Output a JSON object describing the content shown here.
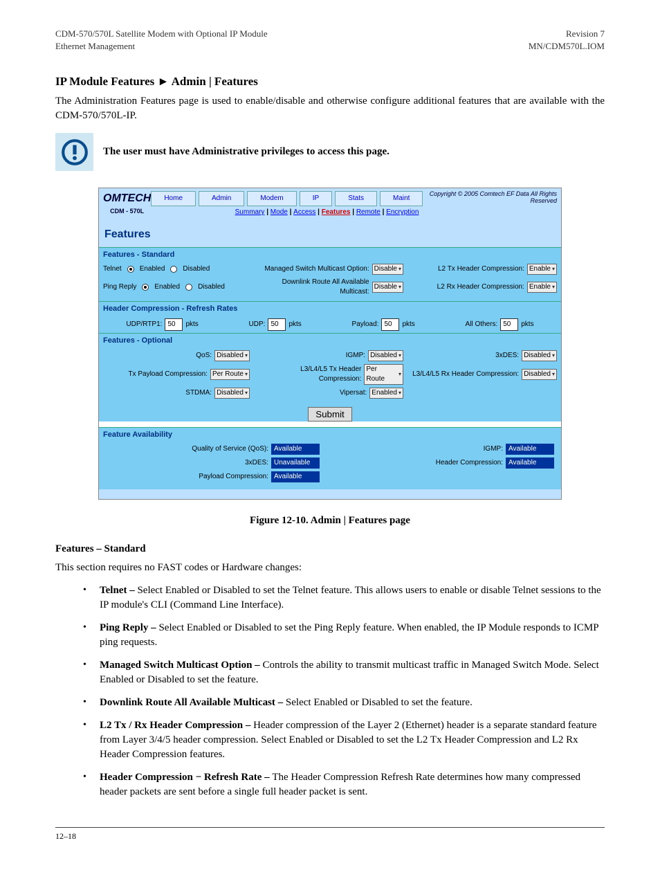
{
  "header": {
    "left_line1": "CDM-570/570L Satellite Modem with Optional IP Module",
    "left_line2": "Ethernet Management",
    "right_line1": "Revision 7",
    "right_line2": "MN/CDM570L.IOM"
  },
  "title": "IP Module Features ► Admin | Features",
  "intro": "The Administration Features page is used to enable/disable and otherwise configure additional features that are available with the CDM-570/570L-IP.",
  "alert": "The user must have Administrative privileges to access this page.",
  "screenshot": {
    "brand_line1": "OMTECH",
    "model": "CDM - 570L",
    "tabs": [
      "Home",
      "Admin",
      "Modem",
      "IP",
      "Stats",
      "Maint"
    ],
    "copyright": "Copyright © 2005\nComtech EF Data\nAll Rights Reserved",
    "subnav": [
      {
        "label": "Summary",
        "active": false
      },
      {
        "label": "Mode",
        "active": false
      },
      {
        "label": "Access",
        "active": false
      },
      {
        "label": "Features",
        "active": true
      },
      {
        "label": "Remote",
        "active": false
      },
      {
        "label": "Encryption",
        "active": false
      }
    ],
    "page_title": "Features",
    "sections": {
      "std": {
        "title": "Features - Standard",
        "rows": [
          {
            "label": "Telnet",
            "enabled": "Enabled",
            "disabled": "Disabled",
            "checked": "enabled",
            "rlabel": "Managed Switch Multicast Option:",
            "rvalue": "Disable",
            "r2label": "L2 Tx Header Compression:",
            "r2value": "Enable"
          },
          {
            "label": "Ping Reply",
            "enabled": "Enabled",
            "disabled": "Disabled",
            "checked": "enabled",
            "rlabel": "Downlink Route All Available Multicast:",
            "rvalue": "Disable",
            "r2label": "L2 Rx Header Compression:",
            "r2value": "Enable"
          }
        ]
      },
      "hcr": {
        "title": "Header Compression - Refresh Rates",
        "items": [
          {
            "label": "UDP/RTP1:",
            "value": "50",
            "unit": "pkts"
          },
          {
            "label": "UDP:",
            "value": "50",
            "unit": "pkts"
          },
          {
            "label": "Payload:",
            "value": "50",
            "unit": "pkts"
          },
          {
            "label": "All Others:",
            "value": "50",
            "unit": "pkts"
          }
        ]
      },
      "opt": {
        "title": "Features - Optional",
        "rows": [
          [
            {
              "label": "QoS:",
              "value": "Disabled"
            },
            {
              "label": "IGMP:",
              "value": "Disabled"
            },
            {
              "label": "3xDES:",
              "value": "Disabled"
            }
          ],
          [
            {
              "label": "Tx Payload Compression:",
              "value": "Per Route"
            },
            {
              "label": "L3/L4/L5 Tx Header Compression:",
              "value": "Per Route"
            },
            {
              "label": "L3/L4/L5 Rx Header Compression:",
              "value": "Disabled"
            }
          ],
          [
            {
              "label": "STDMA:",
              "value": "Disabled"
            },
            {
              "label": "Vipersat:",
              "value": "Enabled"
            },
            {
              "label": "",
              "value": ""
            }
          ]
        ],
        "submit": "Submit"
      },
      "avail": {
        "title": "Feature Availability",
        "items": [
          {
            "label": "Quality of Service (QoS):",
            "status": "Available"
          },
          {
            "label": "IGMP:",
            "status": "Available"
          },
          {
            "label": "3xDES:",
            "status": "Unavailable"
          },
          {
            "label": "Header Compression:",
            "status": "Available"
          },
          {
            "label": "Payload Compression:",
            "status": "Available"
          }
        ]
      }
    }
  },
  "caption": "Figure 12-10. Admin | Features page",
  "sub1_title": "Features – Standard",
  "sub1_intro": "This section requires no FAST codes or Hardware changes:",
  "bullets": [
    {
      "b": "Telnet – ",
      "t": "Select Enabled or Disabled to set the Telnet feature. This allows users to enable or disable Telnet sessions to the IP module's CLI (Command Line Interface)."
    },
    {
      "b": "Ping Reply – ",
      "t": "Select Enabled or Disabled to set the Ping Reply feature. When enabled, the IP Module responds to ICMP ping requests."
    },
    {
      "b": "Managed Switch Multicast Option – ",
      "t": "Controls the ability to transmit multicast traffic in Managed Switch Mode. Select Enabled or Disabled to set the feature."
    },
    {
      "b": "Downlink Route All Available Multicast – ",
      "t": "Select Enabled or Disabled to set the feature._nbsp_"
    },
    {
      "b": "L2 Tx / Rx Header Compression – ",
      "t": "Header compression of the Layer 2 (Ethernet) header is a separate standard feature from Layer 3/4/5 header compression. Select Enabled or Disabled to set the L2 Tx Header Compression and L2 Rx Header Compression features."
    },
    {
      "b": "Header Compression − Refresh Rate – ",
      "t": "The Header Compression Refresh Rate determines how many compressed header packets are sent before a single full header packet is sent."
    }
  ],
  "footer": {
    "left": "12–18",
    "right": ""
  }
}
